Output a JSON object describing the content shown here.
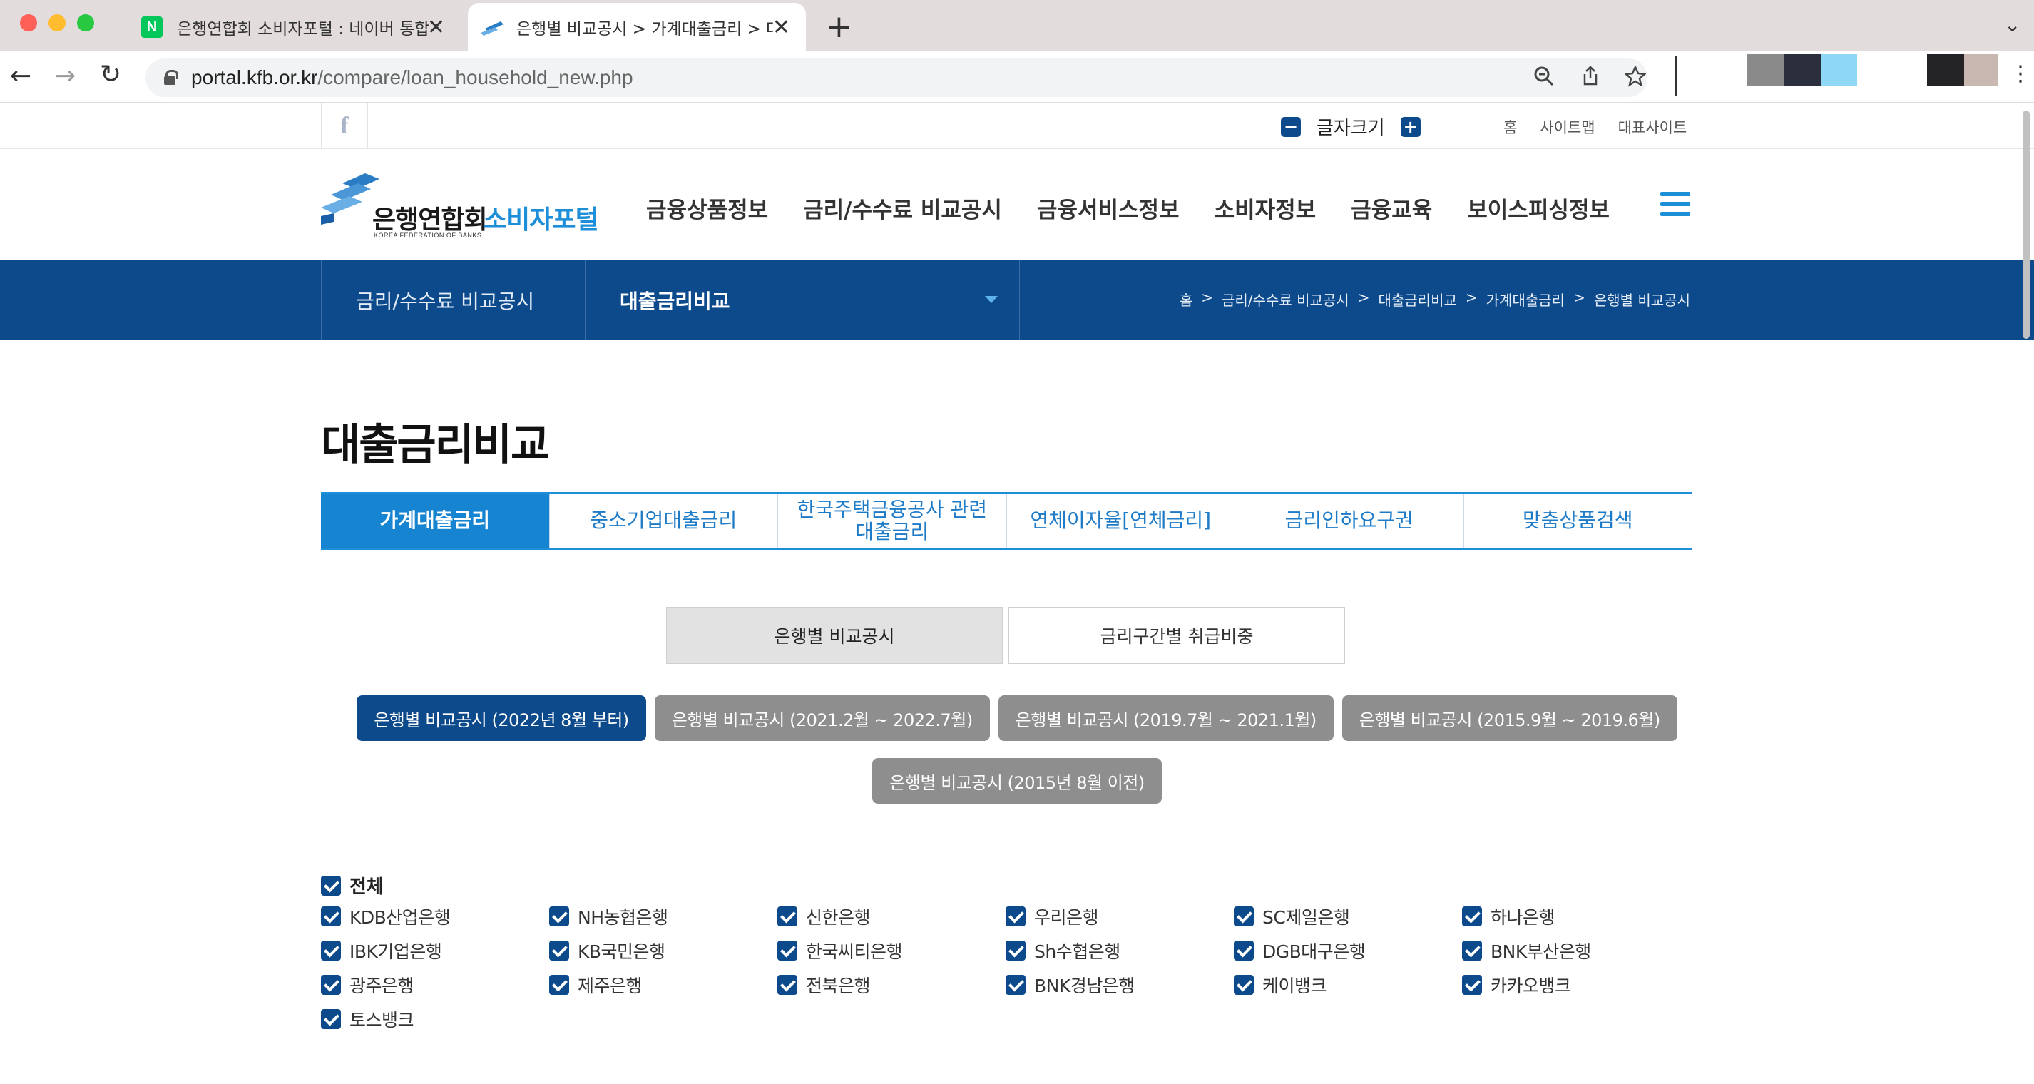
{
  "browser": {
    "tabs": [
      {
        "title": "은행연합회 소비자포털 : 네이버 통합",
        "active": false
      },
      {
        "title": "은행별 비교공시 > 가계대출금리 > 대",
        "active": true
      }
    ],
    "url_host": "portal.kfb.or.kr",
    "url_path": "/compare/loan_household_new.php",
    "new_tab": "+",
    "close_glyph": "✕"
  },
  "util": {
    "facebook": "f",
    "fontsize_label": "글자크기",
    "minus": "−",
    "plus": "+",
    "links": [
      "홈",
      "사이트맵",
      "대표사이트"
    ]
  },
  "logo": {
    "name": "은행연합회",
    "portal": "소비자포털",
    "sub": "KOREA FEDERATION OF BANKS"
  },
  "gnb": [
    "금융상품정보",
    "금리/수수료 비교공시",
    "금융서비스정보",
    "소비자정보",
    "금융교육",
    "보이스피싱정보"
  ],
  "subnav": {
    "section": "금리/수수료 비교공시",
    "current": "대출금리비교",
    "breadcrumb": [
      "홈",
      "금리/수수료 비교공시",
      "대출금리비교",
      "가계대출금리",
      "은행별 비교공시"
    ],
    "sep": ">"
  },
  "page_title": "대출금리비교",
  "tabs": [
    {
      "label": "가계대출금리",
      "active": true
    },
    {
      "label": "중소기업대출금리",
      "active": false
    },
    {
      "label": "한국주택금융공사 관련 대출금리",
      "active": false
    },
    {
      "label": "연체이자율[연체금리]",
      "active": false
    },
    {
      "label": "금리인하요구권",
      "active": false
    },
    {
      "label": "맞춤상품검색",
      "active": false
    }
  ],
  "subtabs": [
    {
      "label": "은행별 비교공시",
      "active": true
    },
    {
      "label": "금리구간별 취급비중",
      "active": false
    }
  ],
  "periods": [
    {
      "label": "은행별 비교공시 (2022년 8월 부터)",
      "active": true
    },
    {
      "label": "은행별 비교공시 (2021.2월 ~ 2022.7월)",
      "active": false
    },
    {
      "label": "은행별 비교공시 (2019.7월 ~ 2021.1월)",
      "active": false
    },
    {
      "label": "은행별 비교공시 (2015.9월 ~ 2019.6월)",
      "active": false
    },
    {
      "label": "은행별 비교공시 (2015년 8월 이전)",
      "active": false
    }
  ],
  "all_label": "전체",
  "banks": [
    "KDB산업은행",
    "NH농협은행",
    "신한은행",
    "우리은행",
    "SC제일은행",
    "하나은행",
    "IBK기업은행",
    "KB국민은행",
    "한국씨티은행",
    "Sh수협은행",
    "DGB대구은행",
    "BNK부산은행",
    "광주은행",
    "제주은행",
    "전북은행",
    "BNK경남은행",
    "케이뱅크",
    "카카오뱅크",
    "토스뱅크"
  ],
  "colors": {
    "primary": "#0d4a8c",
    "accent": "#1d8ed8",
    "tab_active": "#1684d0",
    "inactive_btn": "#8e8e8e"
  }
}
